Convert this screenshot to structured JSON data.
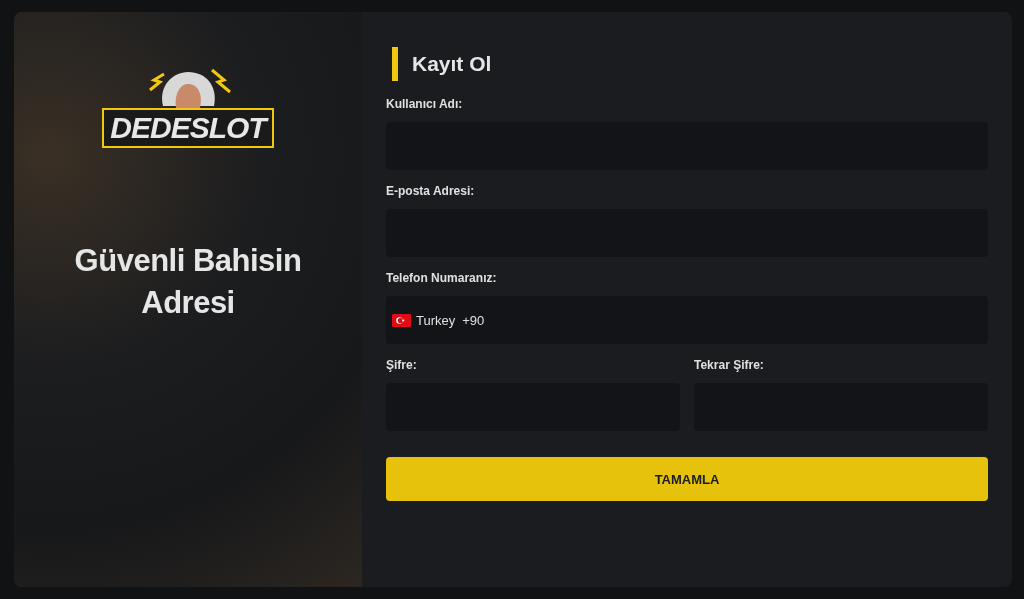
{
  "brand": {
    "logo_text": "DEDESLOT",
    "tagline": "Güvenli Bahisin Adresi"
  },
  "form": {
    "title": "Kayıt Ol",
    "fields": [
      {
        "kind": "text",
        "label": "Kullanıcı Adı:"
      },
      {
        "kind": "text",
        "label": "E-posta Adresi:"
      },
      {
        "kind": "phone",
        "label": "Telefon Numaranız:",
        "country": "Turkey",
        "code": "+90"
      }
    ],
    "password_fields": [
      {
        "label": "Şifre:"
      },
      {
        "label": "Tekrar Şifre:"
      }
    ],
    "submit": "TAMAMLA"
  }
}
